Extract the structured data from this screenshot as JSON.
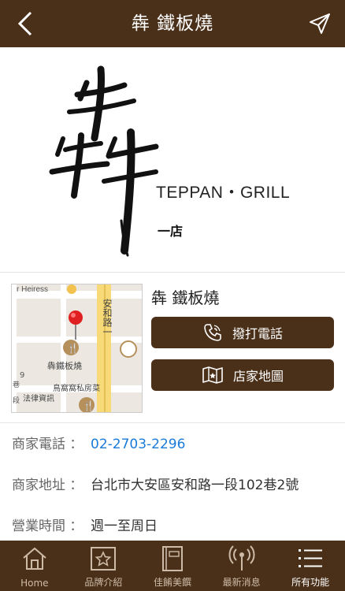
{
  "header": {
    "title": "犇 鐵板燒"
  },
  "hero": {
    "english": "TEPPAN・GRILL",
    "branch": "一店"
  },
  "map": {
    "labels": [
      "r Heiress",
      "安和路一",
      "犇鐵板燒",
      "鳥窩窩私房菜",
      "法律資訊",
      "段",
      "9",
      "巷"
    ]
  },
  "store": {
    "name": "犇 鐵板燒",
    "call_label": "撥打電話",
    "map_label": "店家地圖"
  },
  "details": {
    "phone_label": "商家電話 ：",
    "phone_value": "02-2703-2296",
    "address_label": "商家地址 ：",
    "address_value": "台北市大安區安和路一段102巷2號",
    "hours_label": "營業時間 ：",
    "hours_value": "週一至周日"
  },
  "tabs": [
    {
      "label": "Home",
      "icon": "home-icon"
    },
    {
      "label": "品牌介紹",
      "icon": "star-icon"
    },
    {
      "label": "佳餚美饌",
      "icon": "book-icon"
    },
    {
      "label": "最新消息",
      "icon": "broadcast-icon"
    },
    {
      "label": "所有功能",
      "icon": "menu-list-icon"
    }
  ],
  "colors": {
    "brand": "#4a2f19",
    "link": "#1a7bd9",
    "pin": "#e02020"
  }
}
